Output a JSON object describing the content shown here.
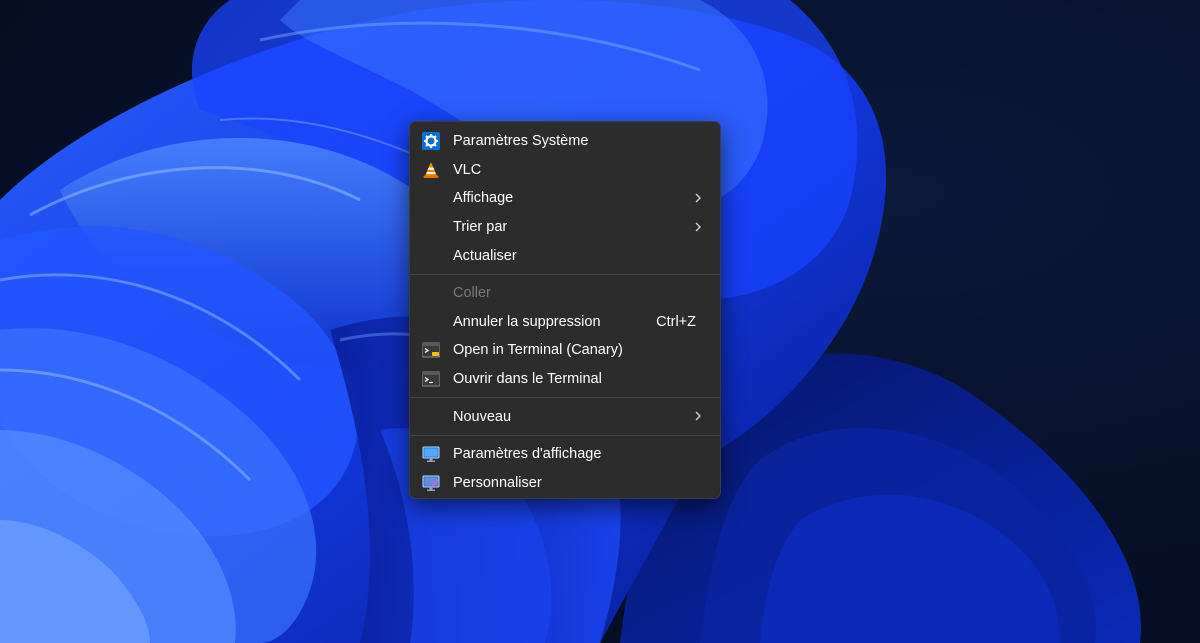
{
  "desktop": {
    "wallpaper_colors": {
      "background": "#061028",
      "petal_dark": "#0a2cc4",
      "petal_mid": "#1a4cff",
      "petal_light": "#3d7bff",
      "petal_highlight": "#7fb0ff"
    }
  },
  "context_menu": {
    "background": "#2c2c2c",
    "groups": [
      {
        "items": [
          {
            "label": "Paramètres Système",
            "icon": "settings-gear-icon",
            "submenu": false
          },
          {
            "label": "VLC",
            "icon": "vlc-cone-icon",
            "submenu": false
          },
          {
            "label": "Affichage",
            "icon": "",
            "submenu": true
          },
          {
            "label": "Trier par",
            "icon": "",
            "submenu": true
          },
          {
            "label": "Actualiser",
            "icon": "",
            "submenu": false
          }
        ]
      },
      {
        "items": [
          {
            "label": "Coller",
            "icon": "",
            "submenu": false,
            "disabled": true
          },
          {
            "label": "Annuler la suppression",
            "shortcut": "Ctrl+Z",
            "icon": "",
            "submenu": false
          },
          {
            "label": "Open in Terminal (Canary)",
            "icon": "terminal-canary-icon",
            "submenu": false
          },
          {
            "label": "Ouvrir dans le Terminal",
            "icon": "terminal-icon",
            "submenu": false
          }
        ]
      },
      {
        "items": [
          {
            "label": "Nouveau",
            "icon": "",
            "submenu": true
          }
        ]
      },
      {
        "items": [
          {
            "label": "Paramètres d'affichage",
            "icon": "display-settings-icon",
            "submenu": false
          },
          {
            "label": "Personnaliser",
            "icon": "personalize-icon",
            "submenu": false
          }
        ]
      }
    ]
  }
}
